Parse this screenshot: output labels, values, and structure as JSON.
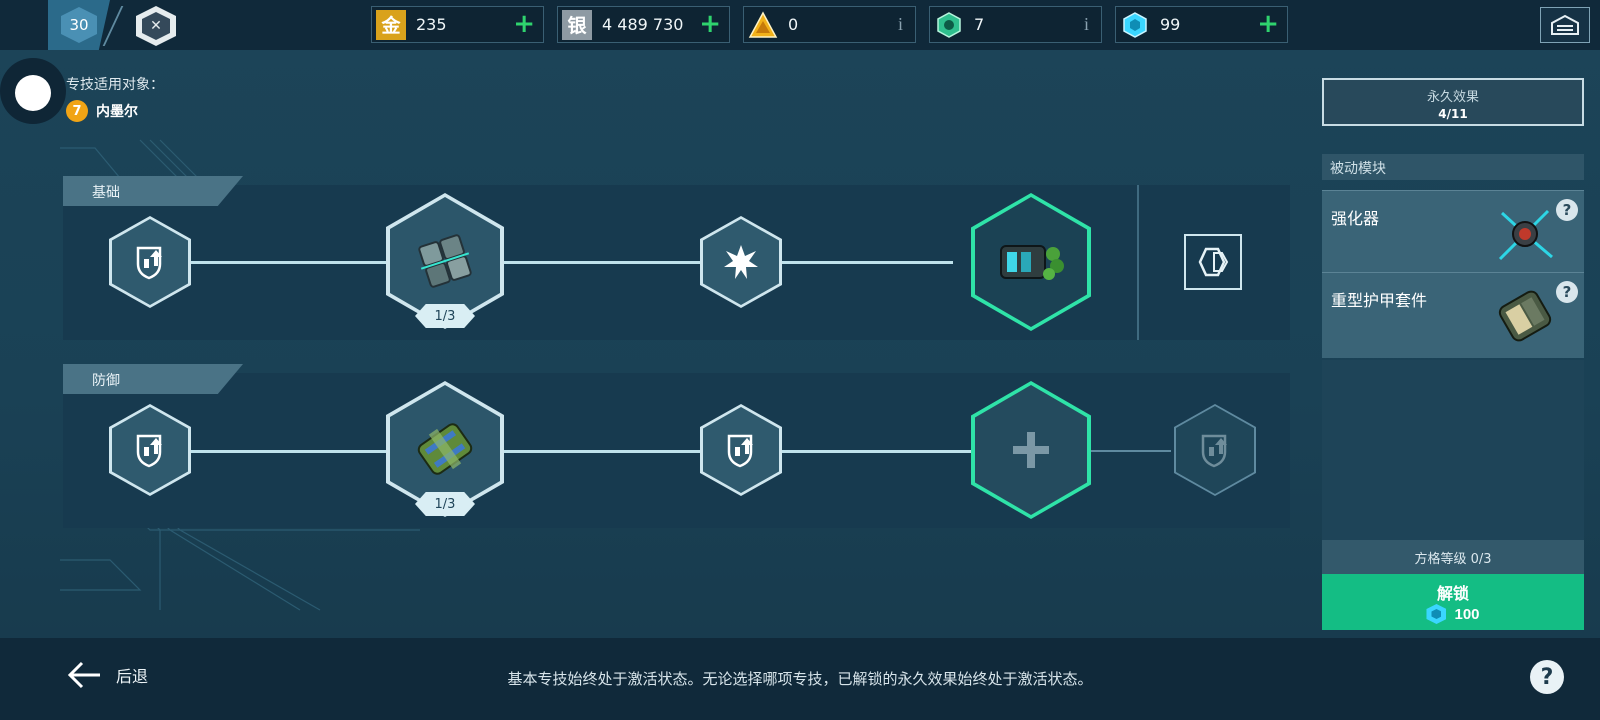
{
  "topbar": {
    "level": "30",
    "currencies": [
      {
        "name": "gold",
        "icon_char": "金",
        "value": "235",
        "action": "plus",
        "color": "#d9a21c"
      },
      {
        "name": "silver",
        "icon_char": "银",
        "value": "4 489 730",
        "action": "plus",
        "color": "#8e9aa3"
      },
      {
        "name": "gold-triangle",
        "icon_char": "",
        "value": "0",
        "action": "info",
        "color": "#f2b21a"
      },
      {
        "name": "green-token",
        "icon_char": "",
        "value": "7",
        "action": "info",
        "color": "#2fbf8e"
      },
      {
        "name": "cyan-hex",
        "icon_char": "",
        "value": "99",
        "action": "plus",
        "color": "#3ad6ff"
      }
    ]
  },
  "header": {
    "applies_to_label": "专技适用对象：",
    "rank": "7",
    "pilot_name": "内墨尔"
  },
  "tree": {
    "rows": [
      {
        "label": "基础",
        "nodes": [
          {
            "type": "stat-upgrade"
          },
          {
            "type": "module",
            "progress": "1/3",
            "tint": "gray-armor"
          },
          {
            "type": "burst"
          },
          {
            "type": "module-active",
            "tint": "green-device"
          }
        ],
        "end_slot": "permanent-effect"
      },
      {
        "label": "防御",
        "nodes": [
          {
            "type": "stat-upgrade"
          },
          {
            "type": "module",
            "progress": "1/3",
            "tint": "green-armor"
          },
          {
            "type": "stat-upgrade"
          },
          {
            "type": "add-slot"
          },
          {
            "type": "stat-upgrade-locked"
          }
        ]
      }
    ]
  },
  "right_panel": {
    "permanent_title": "永久效果",
    "permanent_count": "4/11",
    "passive_header": "被动模块",
    "passive_modules": [
      {
        "name": "强化器",
        "help": "?"
      },
      {
        "name": "重型护甲套件",
        "help": "?"
      }
    ],
    "grid_level": "方格等级 0/3",
    "unlock_label": "解锁",
    "unlock_cost": "100"
  },
  "bottom": {
    "back_label": "后退",
    "hint": "基本专技始终处于激活状态。无论选择哪项专技，已解锁的永久效果始终处于激活状态。",
    "help": "?"
  },
  "colors": {
    "accent_green": "#14bd84",
    "active_border": "#2fe3a8",
    "background": "#1c4458"
  }
}
